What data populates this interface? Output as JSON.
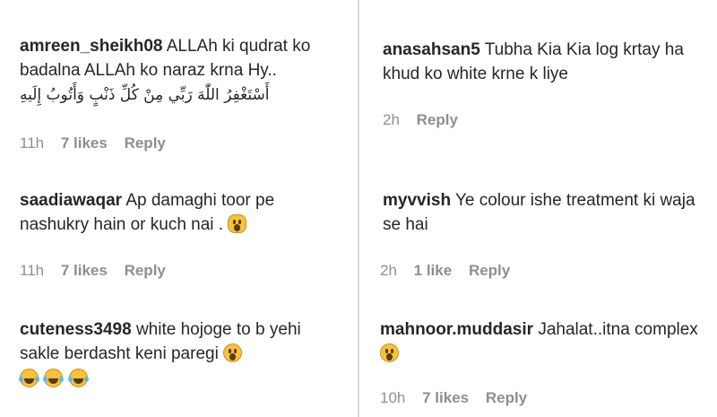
{
  "comments": [
    {
      "user": "amreen_sheikh08",
      "text": "ALLAh ki qudrat ko badalna ALLAh ko naraz krna Hy..",
      "arabic": "أَسْتَغْفِرُ اللّٰهَ رَبِّي مِنْ كُلِّ ذَنْبٍ وَأَتُوبُ إِلَيهِ",
      "time": "11h",
      "likes": "7 likes",
      "reply": "Reply"
    },
    {
      "user": "anasahsan5",
      "text": "Tubha Kia Kia log krtay ha khud ko white krne k liye",
      "time": "2h",
      "likes": "",
      "reply": "Reply"
    },
    {
      "user": "saadiawaqar",
      "text": "Ap damaghi toor pe nashukry hain or kuch nai .",
      "emoji": "screaming-face-icon",
      "time": "11h",
      "likes": "7 likes",
      "reply": "Reply"
    },
    {
      "user": "myvvish",
      "text": "Ye colour ishe treatment ki waja se hai",
      "time": "2h",
      "likes": "1 like",
      "reply": "Reply"
    },
    {
      "user": "cuteness3498",
      "text": "white hojoge to b yehi sakle berdasht keni paregi",
      "emoji": "astonished-face-icon",
      "emoji_row": [
        "face-with-tears-of-joy-icon",
        "face-with-tears-of-joy-icon",
        "face-with-tears-of-joy-icon"
      ]
    },
    {
      "user": "mahnoor.muddasir",
      "text": "Jahalat..itna complex",
      "emoji": "astonished-face-icon",
      "time": "10h",
      "likes": "7 likes",
      "reply": "Reply"
    }
  ],
  "colors": {
    "text": "#262626",
    "meta": "#8e8e8e",
    "divider": "#d9d9d9"
  }
}
